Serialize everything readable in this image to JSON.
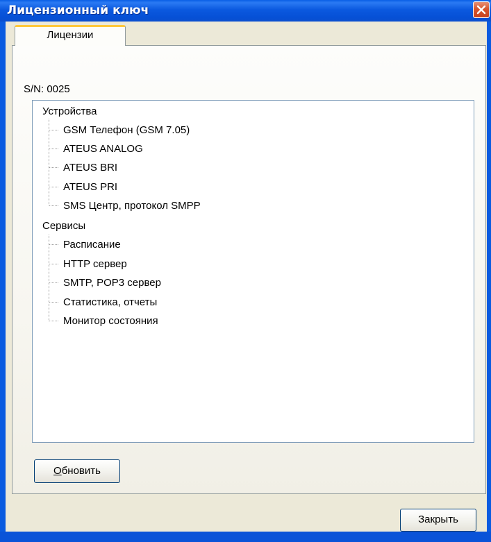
{
  "window": {
    "title": "Лицензионный ключ",
    "close_icon": "close-icon"
  },
  "tabs": [
    {
      "label": "Лицензии",
      "active": true
    }
  ],
  "serial": "S/N: 0025",
  "tree": {
    "groups": [
      {
        "label": "Устройства",
        "items": [
          "GSM Телефон (GSM 7.05)",
          "ATEUS ANALOG",
          "ATEUS BRI",
          "ATEUS PRI",
          "SMS Центр, протокол SMPP"
        ]
      },
      {
        "label": "Сервисы",
        "items": [
          "Расписание",
          "HTTP сервер",
          "SMTP, POP3 сервер",
          "Статистика, отчеты",
          "Монитор состояния"
        ]
      }
    ]
  },
  "buttons": {
    "refresh_accel": "О",
    "refresh_rest": "бновить",
    "close": "Закрыть"
  },
  "colors": {
    "titlebar": "#0a5be0",
    "tab_highlight": "#ffc83c",
    "dialog_bg": "#ece9d8",
    "close_button": "#d8542c"
  }
}
